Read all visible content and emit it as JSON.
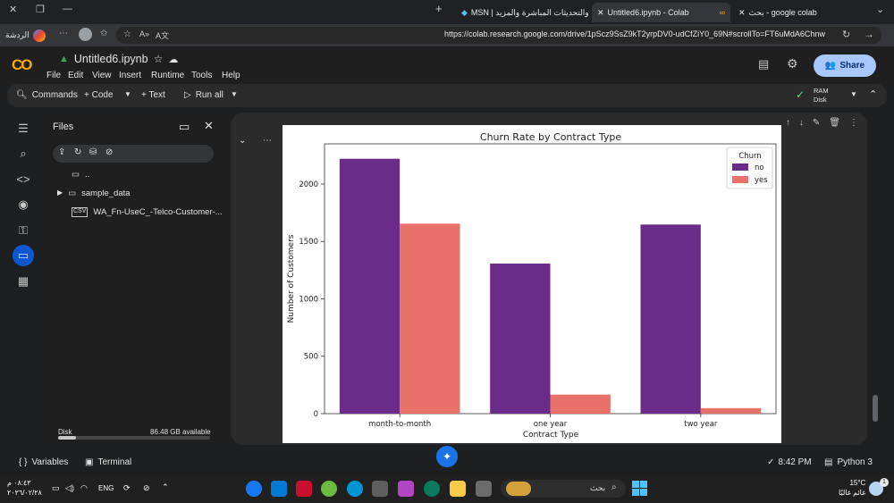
{
  "browser": {
    "tabs": [
      {
        "label": "بحث - google colab",
        "active": false
      },
      {
        "label": "Untitled6.ipynb - Colab",
        "active": true
      },
      {
        "label": "MSN | والتحديثات المباشرة والمزيد",
        "active": false
      }
    ],
    "profile_label": "الردشة",
    "url": "https://colab.research.google.com/drive/1pScz9SsZ9kT2yrpDV0-udCfZiY0_69N#scrollTo=FT6uMdA6Chnw"
  },
  "colab": {
    "notebook_title": "Untitled6.ipynb",
    "menus": [
      "File",
      "Edit",
      "View",
      "Insert",
      "Runtime",
      "Tools",
      "Help"
    ],
    "share_label": "Share",
    "toolbar": {
      "commands": "Commands",
      "code": "+ Code",
      "text": "+ Text",
      "run_all": "Run all",
      "ram": "RAM",
      "disk": "Disk"
    },
    "files_panel": {
      "title": "Files",
      "items": [
        "..",
        "sample_data",
        "WA_Fn-UseC_-Telco-Customer-..."
      ],
      "disk_label": "Disk",
      "disk_available": "86.48 GB available",
      "disk_used_fraction": 0.12
    },
    "status": {
      "variables": "Variables",
      "terminal": "Terminal",
      "time": "8:42 PM",
      "kernel": "Python 3"
    }
  },
  "chart_data": {
    "type": "bar",
    "title": "Churn Rate by Contract Type",
    "xlabel": "Contract Type",
    "ylabel": "Number of Customers",
    "categories": [
      "month-to-month",
      "one year",
      "two year"
    ],
    "series": [
      {
        "name": "no",
        "values": [
          2220,
          1307,
          1647
        ],
        "color": "#6a2c88"
      },
      {
        "name": "yes",
        "values": [
          1655,
          166,
          48
        ],
        "color": "#e8716a"
      }
    ],
    "ylim": [
      0,
      2350
    ],
    "yticks": [
      "0",
      "500",
      "1000",
      "1500",
      "2000"
    ],
    "legend": {
      "title": "Churn",
      "placement": "top-right"
    },
    "grid": false
  },
  "taskbar": {
    "lang": "ENG",
    "weather_temp": "15°C",
    "weather_desc": "غائم غالبًا",
    "search_placeholder": "بحث",
    "clock_time": "٠٨:٤٢ م",
    "clock_date": "٢٠٢٦/٠٢/٢٨",
    "notification_count": "1"
  }
}
